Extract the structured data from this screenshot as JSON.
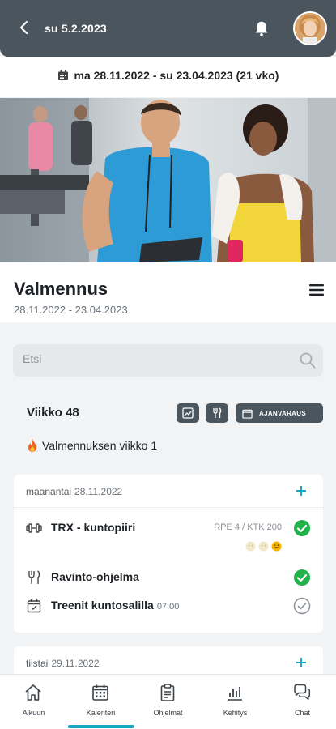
{
  "header": {
    "date": "su 5.2.2023"
  },
  "range": {
    "text": "ma 28.11.2022 - su 23.04.2023 (21 vko)"
  },
  "program": {
    "title": "Valmennus",
    "dates": "28.11.2022 - 23.04.2023"
  },
  "search": {
    "placeholder": "Etsi"
  },
  "week": {
    "title": "Viikko 48",
    "booking_label": "AJANVARAUS",
    "note": "Valmennuksen viikko 1"
  },
  "days": [
    {
      "name": "maanantai",
      "date": "28.11.2022",
      "activities": [
        {
          "title": "TRX - kuntopiiri",
          "meta": "RPE 4 / KTK 200",
          "icon": "dumbbell-icon",
          "status": "done"
        },
        {
          "title": "Ravinto-ohjelma",
          "icon": "cutlery-icon",
          "status": "done"
        },
        {
          "title": "Treenit kuntosalilla",
          "time": "07:00",
          "icon": "calendar-check-icon",
          "status": "pending"
        }
      ]
    },
    {
      "name": "tiistai",
      "date": "29.11.2022"
    }
  ],
  "nav": [
    {
      "label": "Alkuun",
      "icon": "home-icon"
    },
    {
      "label": "Kalenteri",
      "icon": "calendar-icon",
      "active": true
    },
    {
      "label": "Ohjelmat",
      "icon": "clipboard-icon"
    },
    {
      "label": "Kehitys",
      "icon": "bar-chart-icon"
    },
    {
      "label": "Chat",
      "icon": "chat-icon"
    }
  ],
  "colors": {
    "header_bg": "#4a555e",
    "accent": "#1aa7c8",
    "success": "#22b24c"
  }
}
